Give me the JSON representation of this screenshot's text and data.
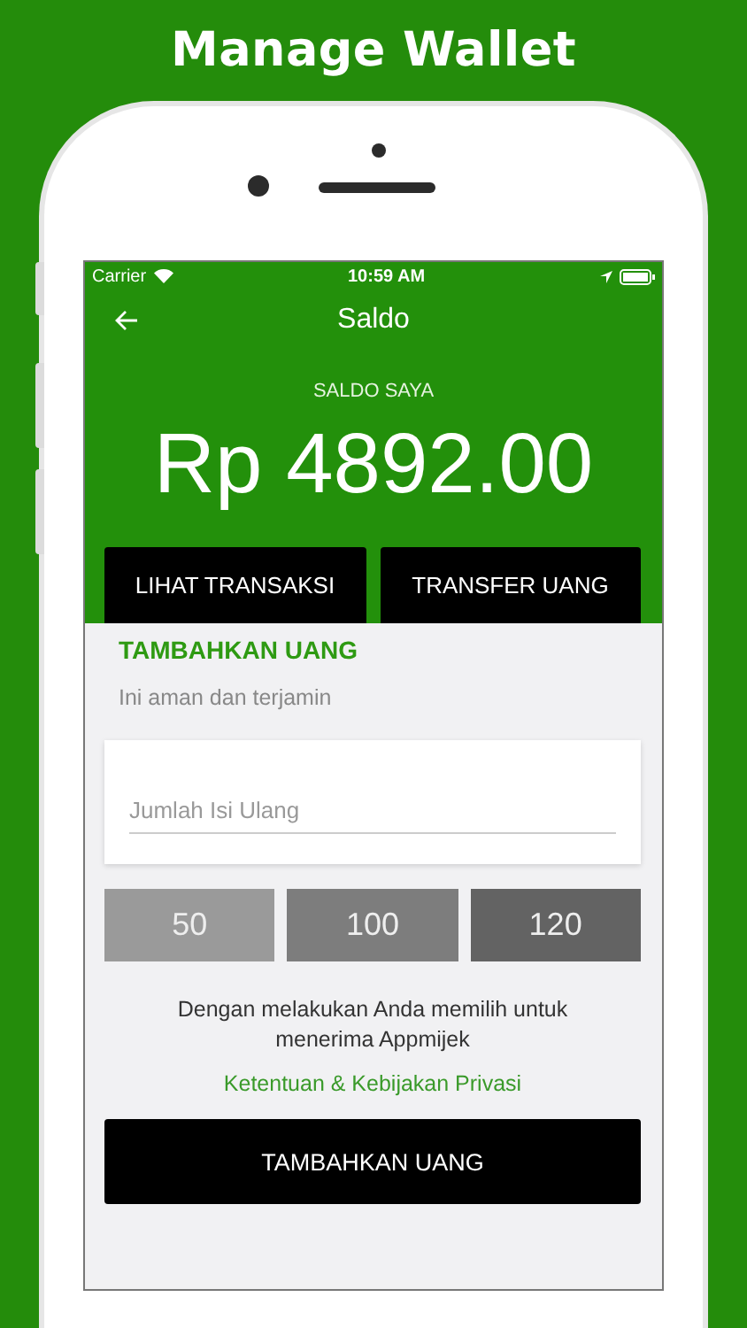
{
  "headline": "Manage Wallet",
  "status_bar": {
    "carrier": "Carrier",
    "time": "10:59 AM"
  },
  "nav": {
    "title": "Saldo"
  },
  "balance": {
    "label": "SALDO SAYA",
    "amount": "Rp 4892.00"
  },
  "actions": [
    "LIHAT TRANSAKSI",
    "TRANSFER UANG"
  ],
  "top_up": {
    "title": "TAMBAHKAN UANG",
    "subtitle": "Ini aman dan terjamin",
    "amount_field": {
      "placeholder": "Jumlah Isi Ulang"
    },
    "presets": [
      {
        "label": "50",
        "color": "#9a9a9a"
      },
      {
        "label": "100",
        "color": "#7d7d7d"
      },
      {
        "label": "120",
        "color": "#636363"
      }
    ],
    "notice": "Dengan melakukan Anda memilih untuk menerima Appmijek",
    "terms_link": "Ketentuan & Kebijakan Privasi",
    "submit": "TAMBAHKAN UANG"
  }
}
